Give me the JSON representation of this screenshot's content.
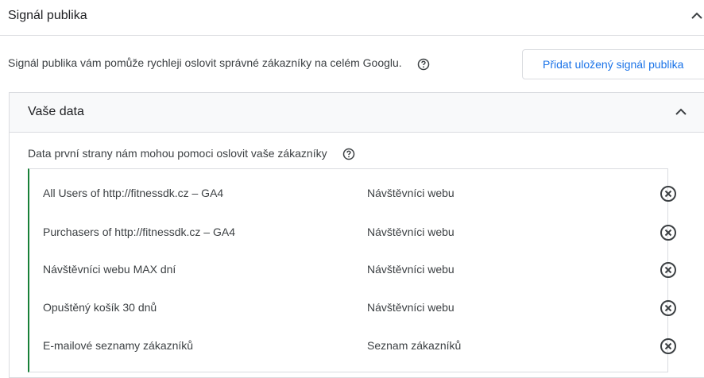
{
  "section": {
    "title": "Signál publika",
    "description": "Signál publika vám pomůže rychleji oslovit správné zákazníky na celém Googlu.",
    "add_button_label": "Přidat uložený signál publika"
  },
  "your_data": {
    "title": "Vaše data",
    "subtitle": "Data první strany nám mohou pomoci oslovit vaše zákazníky",
    "items": [
      {
        "name": "All Users of http://fitnessdk.cz – GA4",
        "type": "Návštěvníci webu"
      },
      {
        "name": "Purchasers of http://fitnessdk.cz – GA4",
        "type": "Návštěvníci webu"
      },
      {
        "name": "Návštěvníci webu MAX dní",
        "type": "Návštěvníci webu"
      },
      {
        "name": "Opuštěný košík 30 dnů",
        "type": "Návštěvníci webu"
      },
      {
        "name": "E-mailové seznamy zákazníků",
        "type": "Seznam zákazníků"
      }
    ]
  },
  "icons": {
    "collapse": "chevron-up-icon",
    "help": "help-circle-icon",
    "remove": "remove-circle-x-icon"
  },
  "colors": {
    "accent_blue": "#1a73e8",
    "list_accent_green": "#188038",
    "border": "#dadce0",
    "panel_header_bg": "#f8f9fa"
  }
}
